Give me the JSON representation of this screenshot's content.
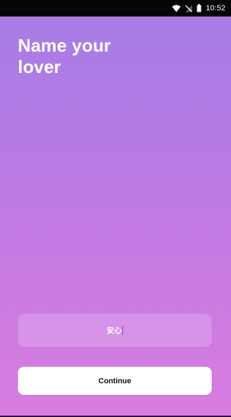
{
  "status_bar": {
    "time": "10:52",
    "icons": [
      "wifi-icon",
      "signal-icon",
      "battery-icon"
    ]
  },
  "page": {
    "title": "Name your lover",
    "background_colors": [
      "#a67ee6",
      "#d97ce0"
    ]
  },
  "name_field": {
    "value": "安心"
  },
  "continue_button": {
    "label": "Continue"
  }
}
